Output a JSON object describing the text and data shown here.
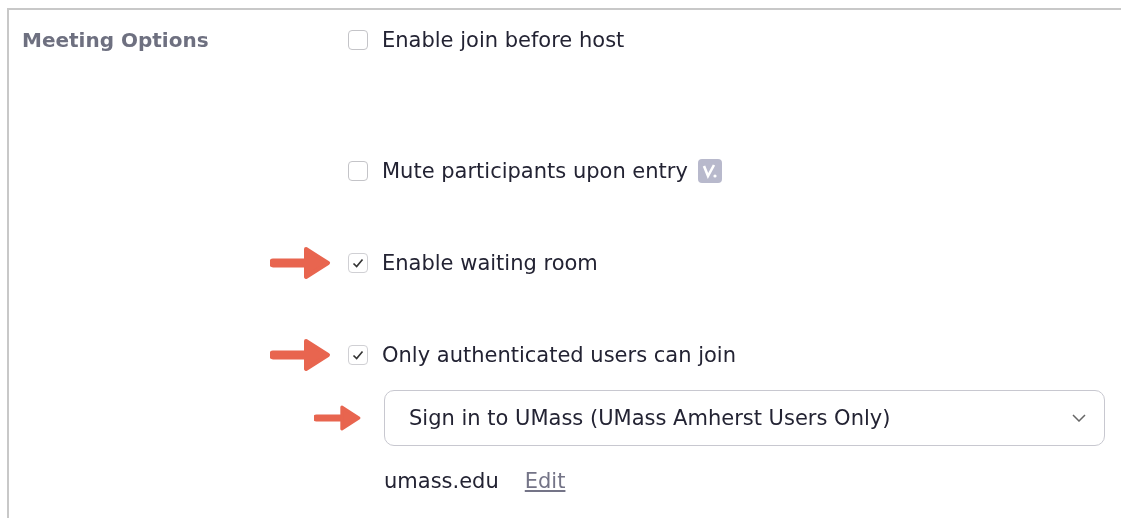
{
  "section": {
    "label": "Meeting Options"
  },
  "options": [
    {
      "label": "Enable join before host",
      "checked": false,
      "badge": false,
      "annotated": false
    },
    {
      "label": "Mute participants upon entry",
      "checked": false,
      "badge": true,
      "annotated": false
    },
    {
      "label": "Enable waiting room",
      "checked": true,
      "badge": false,
      "annotated": true
    },
    {
      "label": "Only authenticated users can join",
      "checked": true,
      "badge": false,
      "annotated": true
    }
  ],
  "auth_dropdown": {
    "value": "Sign in to UMass (UMass Amherst Users Only)",
    "annotated": true
  },
  "domain": {
    "text": "umass.edu",
    "link": "Edit"
  }
}
